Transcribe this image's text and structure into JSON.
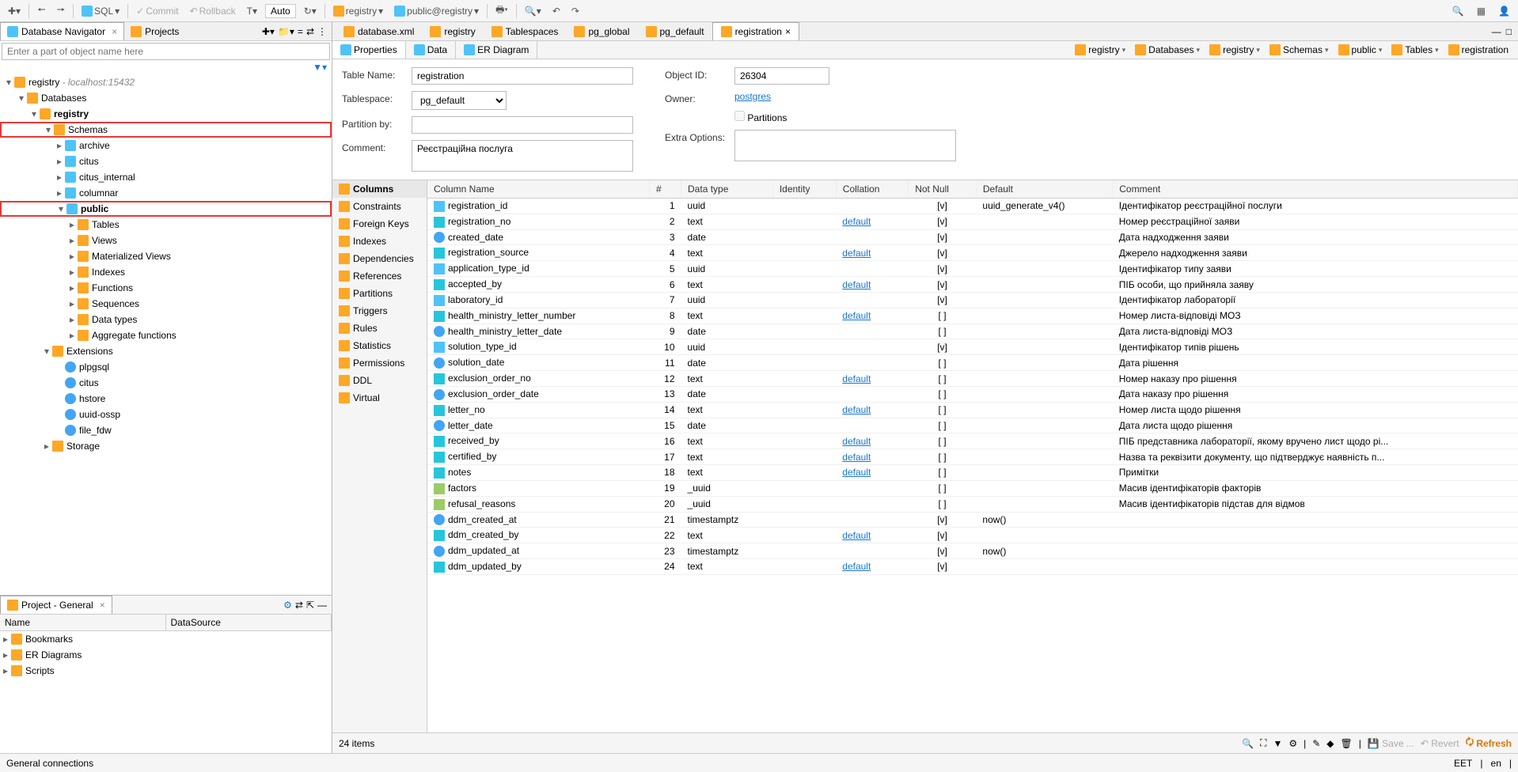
{
  "toolbar": {
    "sql": "SQL",
    "commit": "Commit",
    "rollback": "Rollback",
    "auto": "Auto",
    "conn1": "registry",
    "conn2": "public@registry"
  },
  "navigator": {
    "tab1": "Database Navigator",
    "tab2": "Projects",
    "search_placeholder": "Enter a part of object name here",
    "root_name": "registry",
    "root_host": "- localhost:15432",
    "databases": "Databases",
    "db": "registry",
    "schemas": "Schemas",
    "schema_items": [
      "archive",
      "citus",
      "citus_internal",
      "columnar"
    ],
    "public": "public",
    "public_children": [
      "Tables",
      "Views",
      "Materialized Views",
      "Indexes",
      "Functions",
      "Sequences",
      "Data types",
      "Aggregate functions"
    ],
    "extensions": "Extensions",
    "ext_items": [
      "plpgsql",
      "citus",
      "hstore",
      "uuid-ossp",
      "file_fdw"
    ],
    "storage": "Storage"
  },
  "project_panel": {
    "title": "Project - General",
    "col1": "Name",
    "col2": "DataSource",
    "items": [
      "Bookmarks",
      "ER Diagrams",
      "Scripts"
    ]
  },
  "editor_tabs": [
    "database.xml",
    "registry",
    "Tablespaces",
    "pg_global",
    "pg_default",
    "registration"
  ],
  "sub_tabs": [
    "Properties",
    "Data",
    "ER Diagram"
  ],
  "breadcrumb": [
    "registry",
    "Databases",
    "registry",
    "Schemas",
    "public",
    "Tables",
    "registration"
  ],
  "form": {
    "table_name_lbl": "Table Name:",
    "table_name": "registration",
    "tablespace_lbl": "Tablespace:",
    "tablespace": "pg_default",
    "partition_lbl": "Partition by:",
    "comment_lbl": "Comment:",
    "comment": "Реєстраційна послуга",
    "object_id_lbl": "Object ID:",
    "object_id": "26304",
    "owner_lbl": "Owner:",
    "owner": "postgres",
    "partitions_lbl": "Partitions",
    "extra_lbl": "Extra Options:"
  },
  "side_tabs": [
    "Columns",
    "Constraints",
    "Foreign Keys",
    "Indexes",
    "Dependencies",
    "References",
    "Partitions",
    "Triggers",
    "Rules",
    "Statistics",
    "Permissions",
    "DDL",
    "Virtual"
  ],
  "grid": {
    "headers": [
      "Column Name",
      "#",
      "Data type",
      "Identity",
      "Collation",
      "Not Null",
      "Default",
      "Comment"
    ],
    "rows": [
      {
        "name": "registration_id",
        "n": 1,
        "type": "uuid",
        "coll": "",
        "nn": "[v]",
        "def": "uuid_generate_v4()",
        "cmt": "Ідентифікатор реєстраційної послуги",
        "ic": "key"
      },
      {
        "name": "registration_no",
        "n": 2,
        "type": "text",
        "coll": "default",
        "nn": "[v]",
        "def": "",
        "cmt": "Номер реєстраційної заяви",
        "ic": "abc"
      },
      {
        "name": "created_date",
        "n": 3,
        "type": "date",
        "coll": "",
        "nn": "[v]",
        "def": "",
        "cmt": "Дата надходження заяви",
        "ic": "blue"
      },
      {
        "name": "registration_source",
        "n": 4,
        "type": "text",
        "coll": "default",
        "nn": "[v]",
        "def": "",
        "cmt": "Джерело надходження заяви",
        "ic": "abc"
      },
      {
        "name": "application_type_id",
        "n": 5,
        "type": "uuid",
        "coll": "",
        "nn": "[v]",
        "def": "",
        "cmt": "Ідентифікатор типу заяви",
        "ic": "key"
      },
      {
        "name": "accepted_by",
        "n": 6,
        "type": "text",
        "coll": "default",
        "nn": "[v]",
        "def": "",
        "cmt": "ПІБ особи, що прийняла заяву",
        "ic": "abc"
      },
      {
        "name": "laboratory_id",
        "n": 7,
        "type": "uuid",
        "coll": "",
        "nn": "[v]",
        "def": "",
        "cmt": "Ідентифікатор лабораторії",
        "ic": "key"
      },
      {
        "name": "health_ministry_letter_number",
        "n": 8,
        "type": "text",
        "coll": "default",
        "nn": "[ ]",
        "def": "",
        "cmt": "Номер листа-відповіді МОЗ",
        "ic": "abc"
      },
      {
        "name": "health_ministry_letter_date",
        "n": 9,
        "type": "date",
        "coll": "",
        "nn": "[ ]",
        "def": "",
        "cmt": "Дата листа-відповіді МОЗ",
        "ic": "blue"
      },
      {
        "name": "solution_type_id",
        "n": 10,
        "type": "uuid",
        "coll": "",
        "nn": "[v]",
        "def": "",
        "cmt": "Ідентифікатор типів рішень",
        "ic": "key"
      },
      {
        "name": "solution_date",
        "n": 11,
        "type": "date",
        "coll": "",
        "nn": "[ ]",
        "def": "",
        "cmt": "Дата рішення",
        "ic": "blue"
      },
      {
        "name": "exclusion_order_no",
        "n": 12,
        "type": "text",
        "coll": "default",
        "nn": "[ ]",
        "def": "",
        "cmt": "Номер наказу про рішення",
        "ic": "abc"
      },
      {
        "name": "exclusion_order_date",
        "n": 13,
        "type": "date",
        "coll": "",
        "nn": "[ ]",
        "def": "",
        "cmt": "Дата наказу про рішення",
        "ic": "blue"
      },
      {
        "name": "letter_no",
        "n": 14,
        "type": "text",
        "coll": "default",
        "nn": "[ ]",
        "def": "",
        "cmt": "Номер листа щодо рішення",
        "ic": "abc"
      },
      {
        "name": "letter_date",
        "n": 15,
        "type": "date",
        "coll": "",
        "nn": "[ ]",
        "def": "",
        "cmt": "Дата листа щодо рішення",
        "ic": "blue"
      },
      {
        "name": "received_by",
        "n": 16,
        "type": "text",
        "coll": "default",
        "nn": "[ ]",
        "def": "",
        "cmt": "ПІБ представника лабораторії, якому вручено лист щодо рі...",
        "ic": "abc"
      },
      {
        "name": "certified_by",
        "n": 17,
        "type": "text",
        "coll": "default",
        "nn": "[ ]",
        "def": "",
        "cmt": "Назва та реквізити документу, що підтверджує наявність п...",
        "ic": "abc"
      },
      {
        "name": "notes",
        "n": 18,
        "type": "text",
        "coll": "default",
        "nn": "[ ]",
        "def": "",
        "cmt": "Примітки",
        "ic": "abc"
      },
      {
        "name": "factors",
        "n": 19,
        "type": "_uuid",
        "coll": "",
        "nn": "[ ]",
        "def": "",
        "cmt": "Масив ідентифікаторів факторів",
        "ic": "arr"
      },
      {
        "name": "refusal_reasons",
        "n": 20,
        "type": "_uuid",
        "coll": "",
        "nn": "[ ]",
        "def": "",
        "cmt": "Масив ідентифікаторів підстав для відмов",
        "ic": "arr"
      },
      {
        "name": "ddm_created_at",
        "n": 21,
        "type": "timestamptz",
        "coll": "",
        "nn": "[v]",
        "def": "now()",
        "cmt": "",
        "ic": "blue"
      },
      {
        "name": "ddm_created_by",
        "n": 22,
        "type": "text",
        "coll": "default",
        "nn": "[v]",
        "def": "",
        "cmt": "",
        "ic": "abc"
      },
      {
        "name": "ddm_updated_at",
        "n": 23,
        "type": "timestamptz",
        "coll": "",
        "nn": "[v]",
        "def": "now()",
        "cmt": "",
        "ic": "blue"
      },
      {
        "name": "ddm_updated_by",
        "n": 24,
        "type": "text",
        "coll": "default",
        "nn": "[v]",
        "def": "",
        "cmt": "",
        "ic": "abc"
      }
    ],
    "footer": "24 items"
  },
  "bottom_bar": {
    "save": "Save ...",
    "revert": "Revert",
    "refresh": "Refresh"
  },
  "status": {
    "left": "General connections",
    "eet": "EET",
    "lang": "en"
  }
}
